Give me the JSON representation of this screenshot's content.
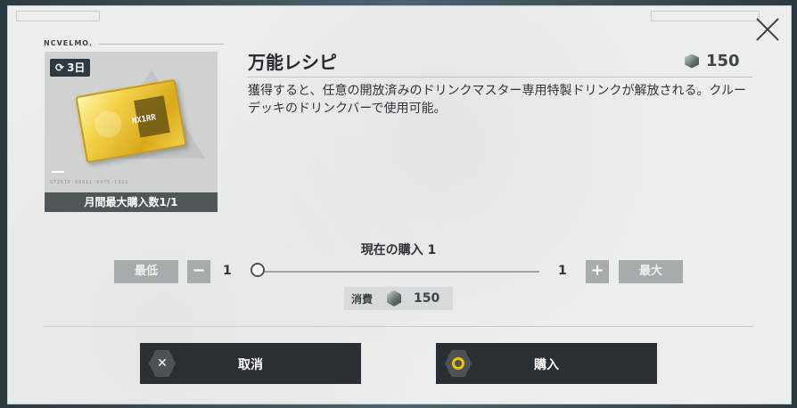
{
  "header": {
    "brand": "NCVELMO.",
    "close_icon": "close-icon"
  },
  "item": {
    "timer_label": "3日",
    "timer_icon": "refresh-icon",
    "card_text": "NX1RR",
    "serial": "ST25TP-BR011-0475-1311",
    "monthly_limit": "月間最大購入数1/1",
    "title": "万能レシピ",
    "price": "150",
    "price_icon": "currency-gem-icon",
    "description": "獲得すると、任意の開放済みのドリンクマスター専用特製ドリンクが解放される。クルーデッキのドリンクバーで使用可能。"
  },
  "purchase": {
    "current_label": "現在の購入 1",
    "min_label": "最低",
    "max_label": "最大",
    "decrement_label": "−",
    "increment_label": "+",
    "quantity_min": "1",
    "quantity_max": "1",
    "slider_value": 1,
    "cost_label": "消費",
    "cost_value": "150",
    "cost_icon": "currency-gem-icon"
  },
  "actions": {
    "cancel_label": "取消",
    "buy_label": "購入"
  },
  "colors": {
    "modal_bg": "#eceeed",
    "action_button_bg": "#2b3034",
    "accent_yellow": "#f2c100",
    "disabled_button": "#a6abac"
  }
}
